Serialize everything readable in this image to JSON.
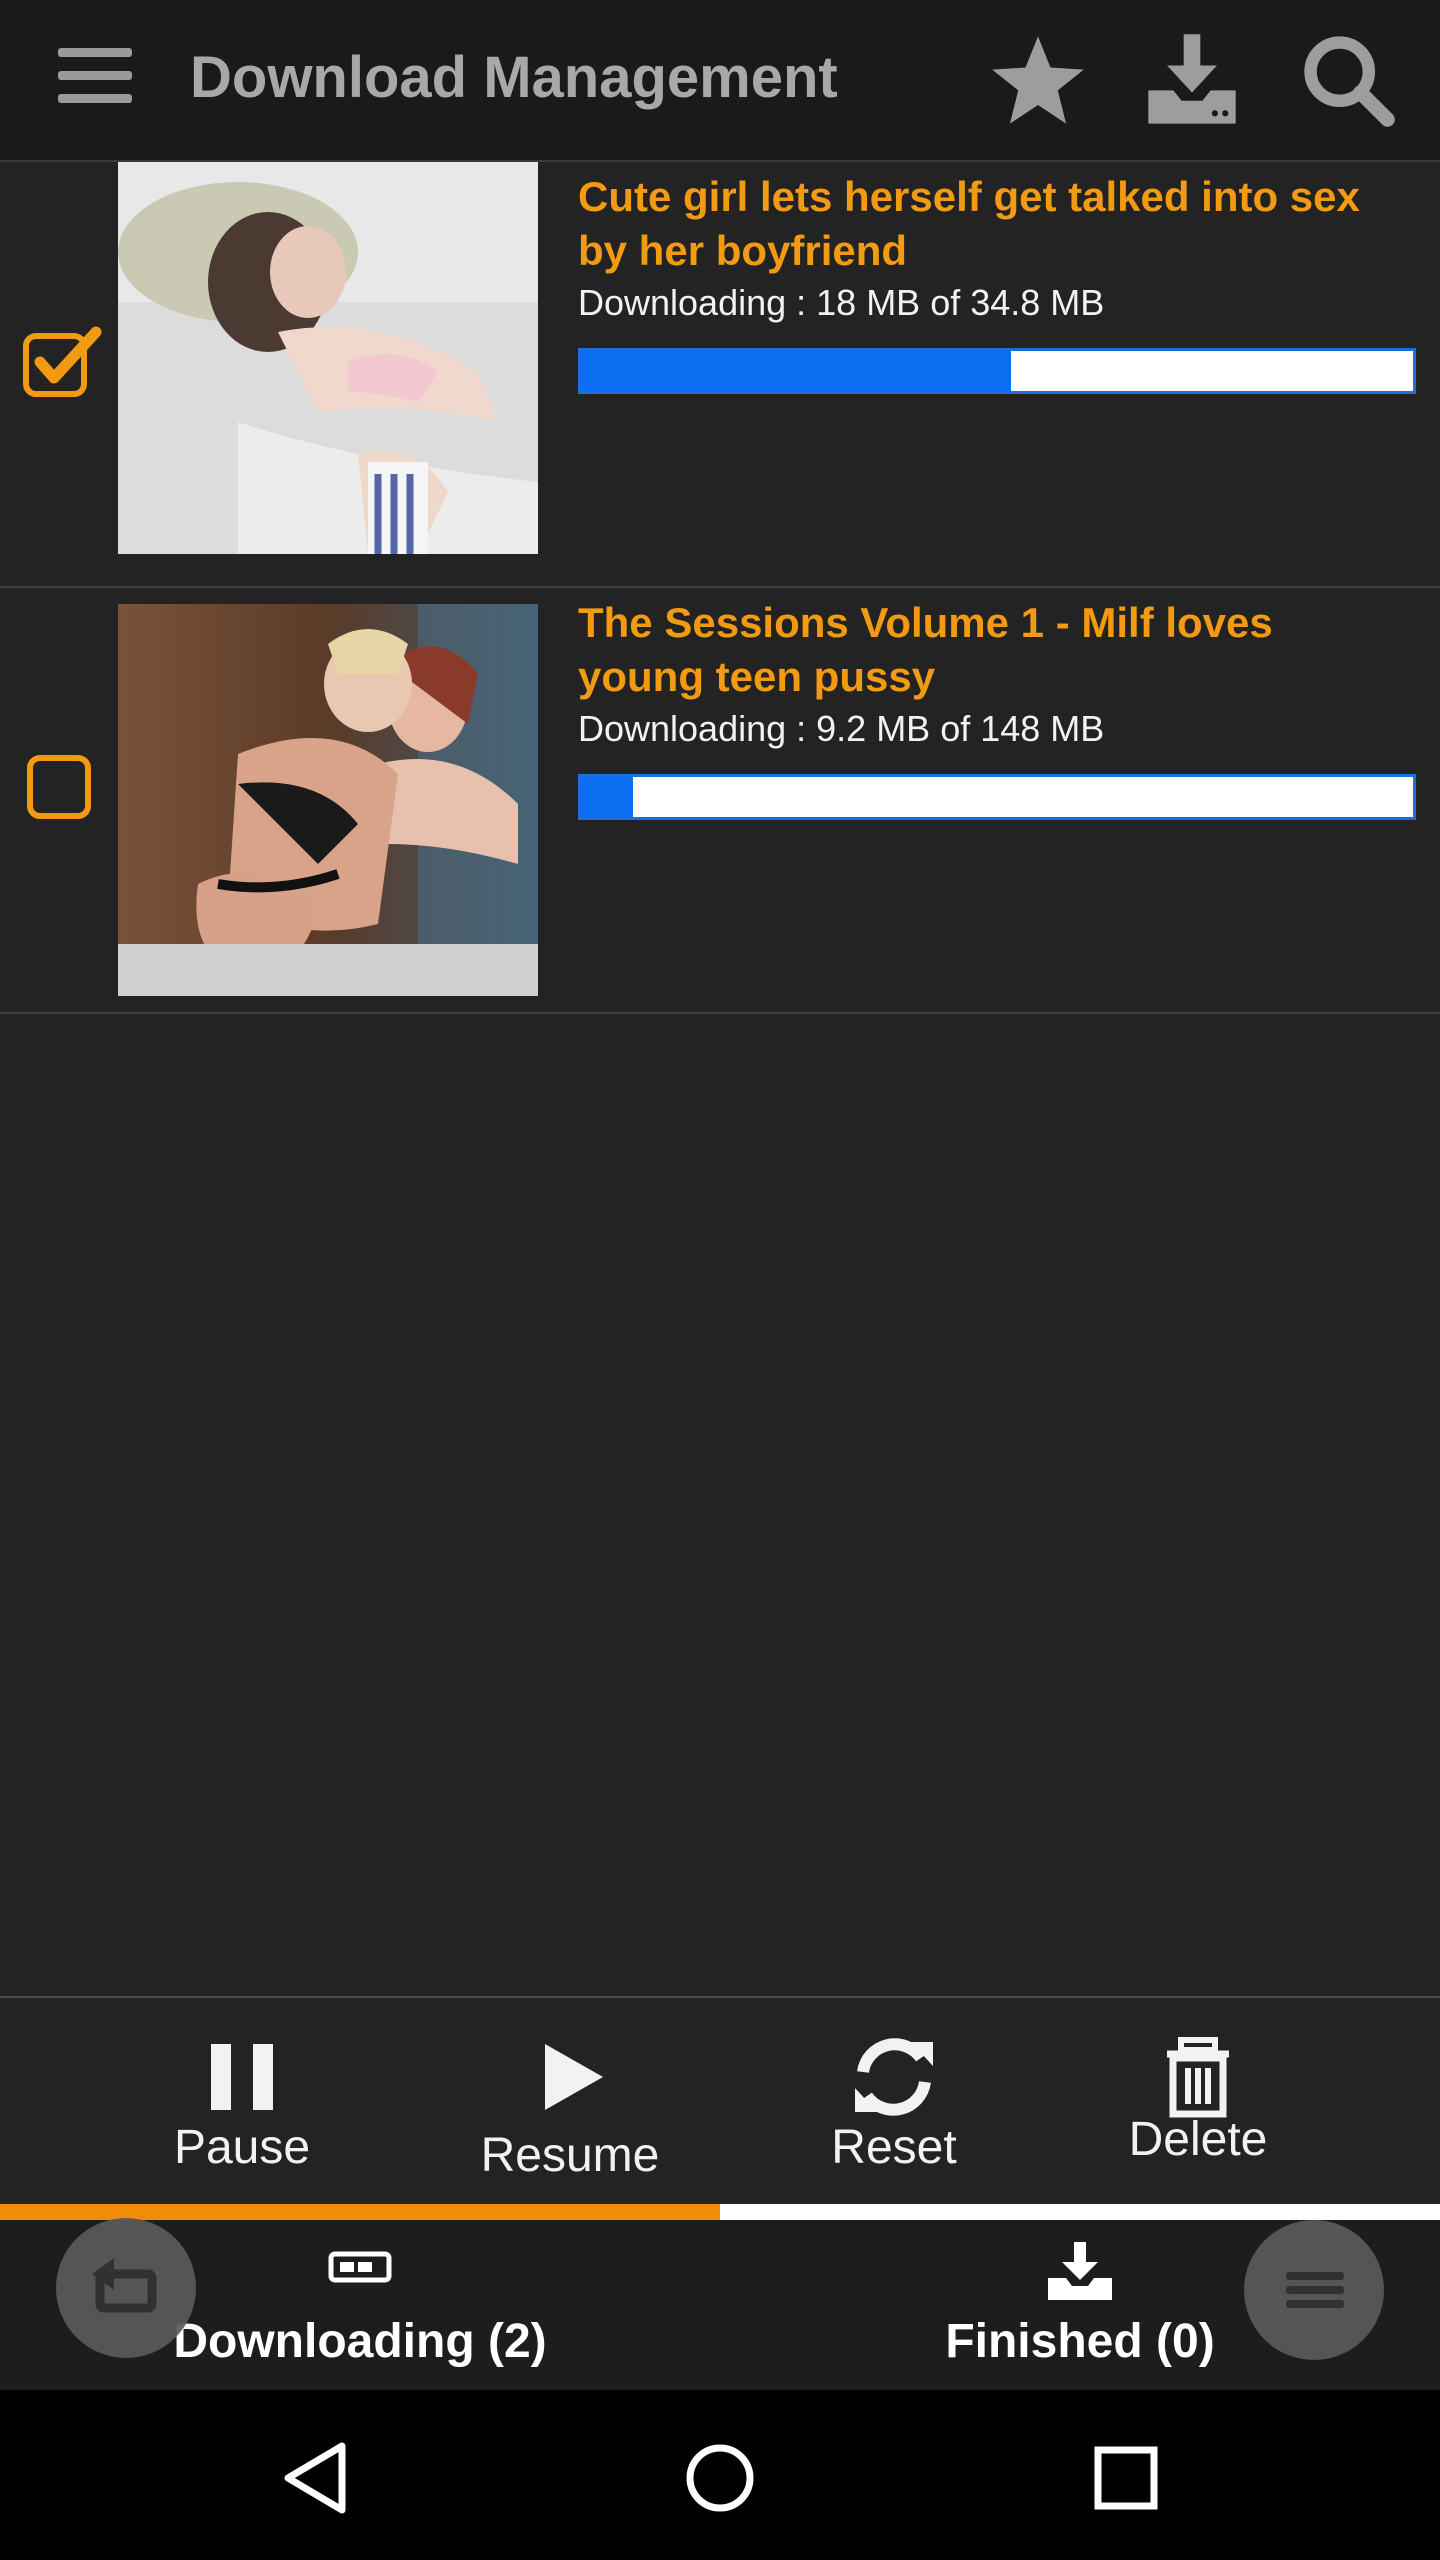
{
  "app": {
    "title": "Download Management"
  },
  "icons": {
    "menu": "hamburger-menu-icon",
    "favorites": "star-icon",
    "downloads": "download-tray-icon",
    "search": "search-icon"
  },
  "colors": {
    "accent": "#f29a12",
    "progress": "#0a6ff0",
    "background": "#232323"
  },
  "downloads": [
    {
      "title": "Cute girl lets herself get talked into sex by her boyfriend",
      "status": "Downloading : 18 MB of 34.8 MB",
      "progress": 0.517,
      "checked": true
    },
    {
      "title": "The Sessions Volume 1 - Milf loves young teen pussy",
      "status": "Downloading : 9.2 MB of 148 MB",
      "progress": 0.062,
      "checked": false
    }
  ],
  "actions": {
    "pause": "Pause",
    "resume": "Resume",
    "reset": "Reset",
    "delete": "Delete"
  },
  "tabs": {
    "downloading": "Downloading (2)",
    "finished": "Finished (0)",
    "active": "downloading"
  }
}
